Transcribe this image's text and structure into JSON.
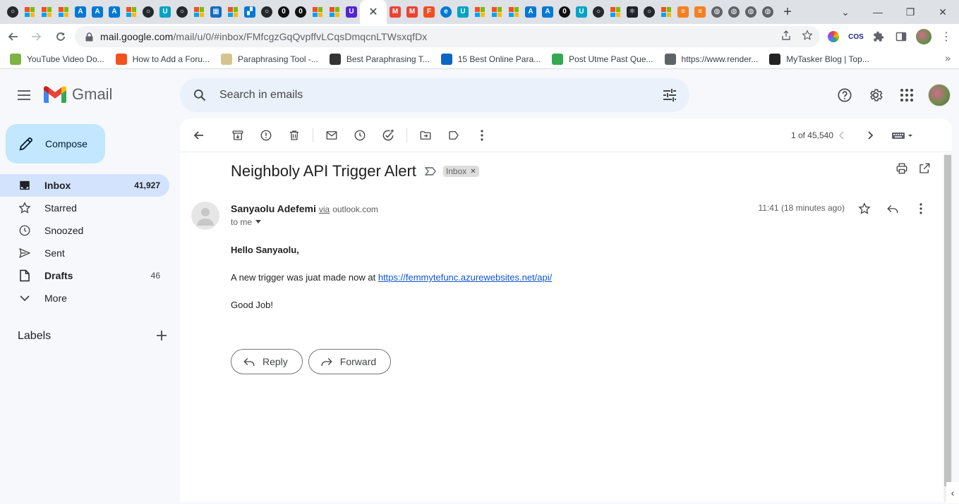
{
  "browser": {
    "active_tab_close": "✕",
    "new_tab": "+",
    "url_host": "mail.google.com",
    "url_path": "/mail/u/0/#inbox/FMfcgzGqQvpffvLCqsDmqcnLTWsxqfDx",
    "bookmarks": [
      {
        "label": "YouTube Video Do...",
        "icon": "download-arrow-icon",
        "color": "#7cb342"
      },
      {
        "label": "How to Add a Foru...",
        "icon": "forum-icon",
        "color": "#f4511e"
      },
      {
        "label": "Paraphrasing Tool -...",
        "icon": "quillbot-icon",
        "color": "#d4c58f"
      },
      {
        "label": "Best Paraphrasing T...",
        "icon": "tool-icon",
        "color": "#333333"
      },
      {
        "label": "15 Best Online Para...",
        "icon": "linkedin-icon",
        "color": "#0a66c2"
      },
      {
        "label": "Post Utme Past Que...",
        "icon": "puzzle-icon",
        "color": "#34a853"
      },
      {
        "label": "https://www.render...",
        "icon": "globe-icon",
        "color": "#5f6368"
      },
      {
        "label": "MyTasker Blog | Top...",
        "icon": "mytasker-icon",
        "color": "#222222"
      }
    ]
  },
  "gmail": {
    "app_name": "Gmail",
    "search_placeholder": "Search in emails",
    "compose_label": "Compose",
    "nav": [
      {
        "label": "Inbox",
        "count": "41,927",
        "icon": "inbox-icon"
      },
      {
        "label": "Starred",
        "count": "",
        "icon": "star-icon"
      },
      {
        "label": "Snoozed",
        "count": "",
        "icon": "clock-icon"
      },
      {
        "label": "Sent",
        "count": "",
        "icon": "send-icon"
      },
      {
        "label": "Drafts",
        "count": "46",
        "icon": "draft-icon"
      },
      {
        "label": "More",
        "count": "",
        "icon": "chevron-down-icon"
      }
    ],
    "labels_title": "Labels",
    "pager_text": "1 of 45,540",
    "email": {
      "subject": "Neighboly API Trigger Alert",
      "label_chip": "Inbox",
      "sender_name": "Sanyaolu Adefemi",
      "via": "via",
      "via_domain": "outlook.com",
      "to": "to me",
      "time": "11:41 (18 minutes ago)",
      "greeting": "Hello Sanyaolu,",
      "line_prefix": "A new trigger was juat made now at ",
      "link": "https://femmytefunc.azurewebsites.net/api/",
      "closing": "Good Job!",
      "reply_label": "Reply",
      "forward_label": "Forward"
    }
  },
  "colors": {
    "accent_blue": "#0b57d0",
    "compose_bg": "#c2e7ff",
    "active_nav": "#d3e3fd",
    "search_bg": "#eaf1fb",
    "link": "#1155cc"
  }
}
